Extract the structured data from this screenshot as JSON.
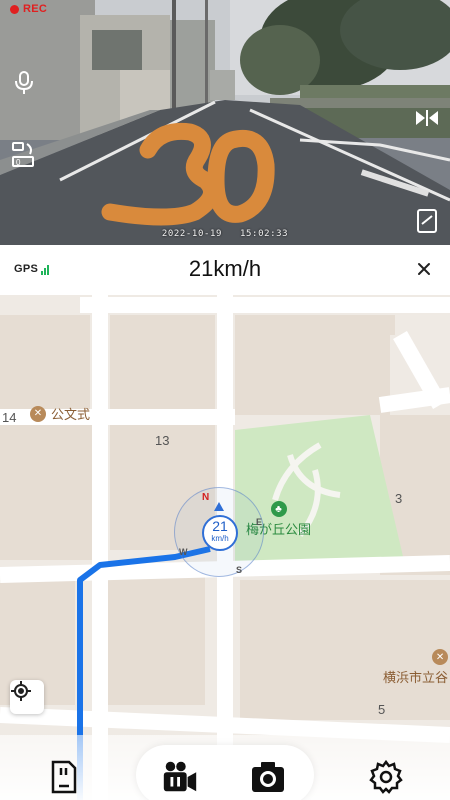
{
  "camera": {
    "rec_label": "REC",
    "date": "2022-10-19",
    "time": "15:02:33",
    "road_marking": "30"
  },
  "header": {
    "gps_label": "GPS",
    "speed_display": "21km/h"
  },
  "map": {
    "block_labels": [
      "14",
      "13",
      "3",
      "5"
    ],
    "poi_school": "公文式",
    "poi_park": "梅が丘公園",
    "poi_area": "横浜市立谷",
    "compass": {
      "speed_value": "21",
      "speed_unit": "km/h",
      "north": "N",
      "east": "E",
      "south": "S",
      "west": "W"
    }
  },
  "icons": {
    "mic": "mic-icon",
    "rotate": "rotate-icon",
    "mirror": "mirror-icon",
    "fullscreen": "fullscreen-icon",
    "close": "close-icon",
    "locate": "locate-icon",
    "sd_card": "sd-card-icon",
    "video": "video-icon",
    "camera": "camera-icon",
    "settings": "gear-icon"
  },
  "colors": {
    "route": "#1a73e8",
    "park": "#cfe8c2",
    "gps_signal": "#1fb45a",
    "rec": "#e02020",
    "road_paint": "#d98a3c"
  }
}
